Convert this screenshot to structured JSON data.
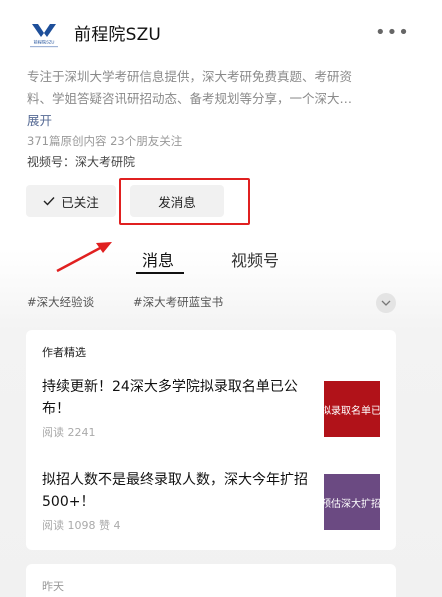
{
  "account": {
    "name": "前程院SZU",
    "logo_text": "前程院SZU",
    "more_icon": "more-icon",
    "description_lines": [
      "专注于深圳大学考研信息提供，深大考研免费真题、考研资",
      "料、学姐答疑咨讯研招动态、备考规划等分享，一个深大…"
    ],
    "expand_label": "展开",
    "stats": "371篇原创内容  23个朋友关注",
    "channel": "视频号：深大考研院"
  },
  "actions": {
    "followed_label": "已关注",
    "message_label": "发消息",
    "highlight_color": "#e02020"
  },
  "tabs": {
    "messages": "消息",
    "channel": "视频号"
  },
  "hashtags": [
    "#深大经验谈",
    "#深大考研蓝宝书"
  ],
  "featured": {
    "title": "作者精选",
    "articles": [
      {
        "title": "持续更新！24深大多学院拟录取名单已公布！",
        "meta": "阅读 2241",
        "thumb_text": "拟录取名单已",
        "thumb_color": "#b11219"
      },
      {
        "title": "拟招人数不是最终录取人数，深大今年扩招500+！",
        "meta": "阅读 1098   赞 4",
        "thumb_text": "预估深大扩招",
        "thumb_color": "#6b4a82"
      }
    ]
  },
  "timeline": {
    "yesterday_label": "昨天"
  }
}
